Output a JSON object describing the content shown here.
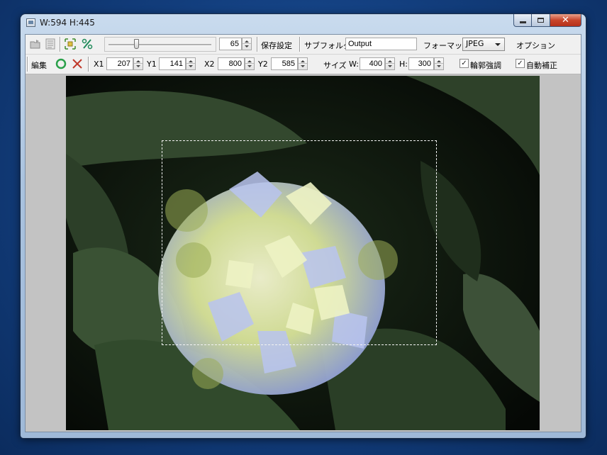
{
  "window": {
    "title": "W:594 H:445"
  },
  "toolbar1": {
    "slider_value": 0.27,
    "quality_value": "65",
    "save_settings_label": "保存設定",
    "subfolder_label": "サブフォルダ",
    "subfolder_value": "Output",
    "format_label": "フォーマット",
    "format_selected": "JPEG",
    "options_label": "オプション"
  },
  "toolbar2": {
    "edit_label": "編集",
    "x1_label": "X1",
    "x1_value": "207",
    "y1_label": "Y1",
    "y1_value": "141",
    "x2_label": "X2",
    "x2_value": "800",
    "y2_label": "Y2",
    "y2_value": "585",
    "size_label": "サイズ",
    "w_label": "W:",
    "w_value": "400",
    "h_label": "H:",
    "h_value": "300",
    "outline_enhance_label": "輪郭強調",
    "outline_enhance_checked": true,
    "auto_correct_label": "自動補正",
    "auto_correct_checked": true
  },
  "icons": [
    "app-icon",
    "open-folder-icon",
    "list-icon",
    "fit-icon",
    "percent-icon",
    "confirm-circle-icon",
    "cancel-x-icon"
  ],
  "colors": {
    "desktop": "#0f3a78",
    "confirm": "#2aa04a",
    "cancel": "#c0392b"
  }
}
